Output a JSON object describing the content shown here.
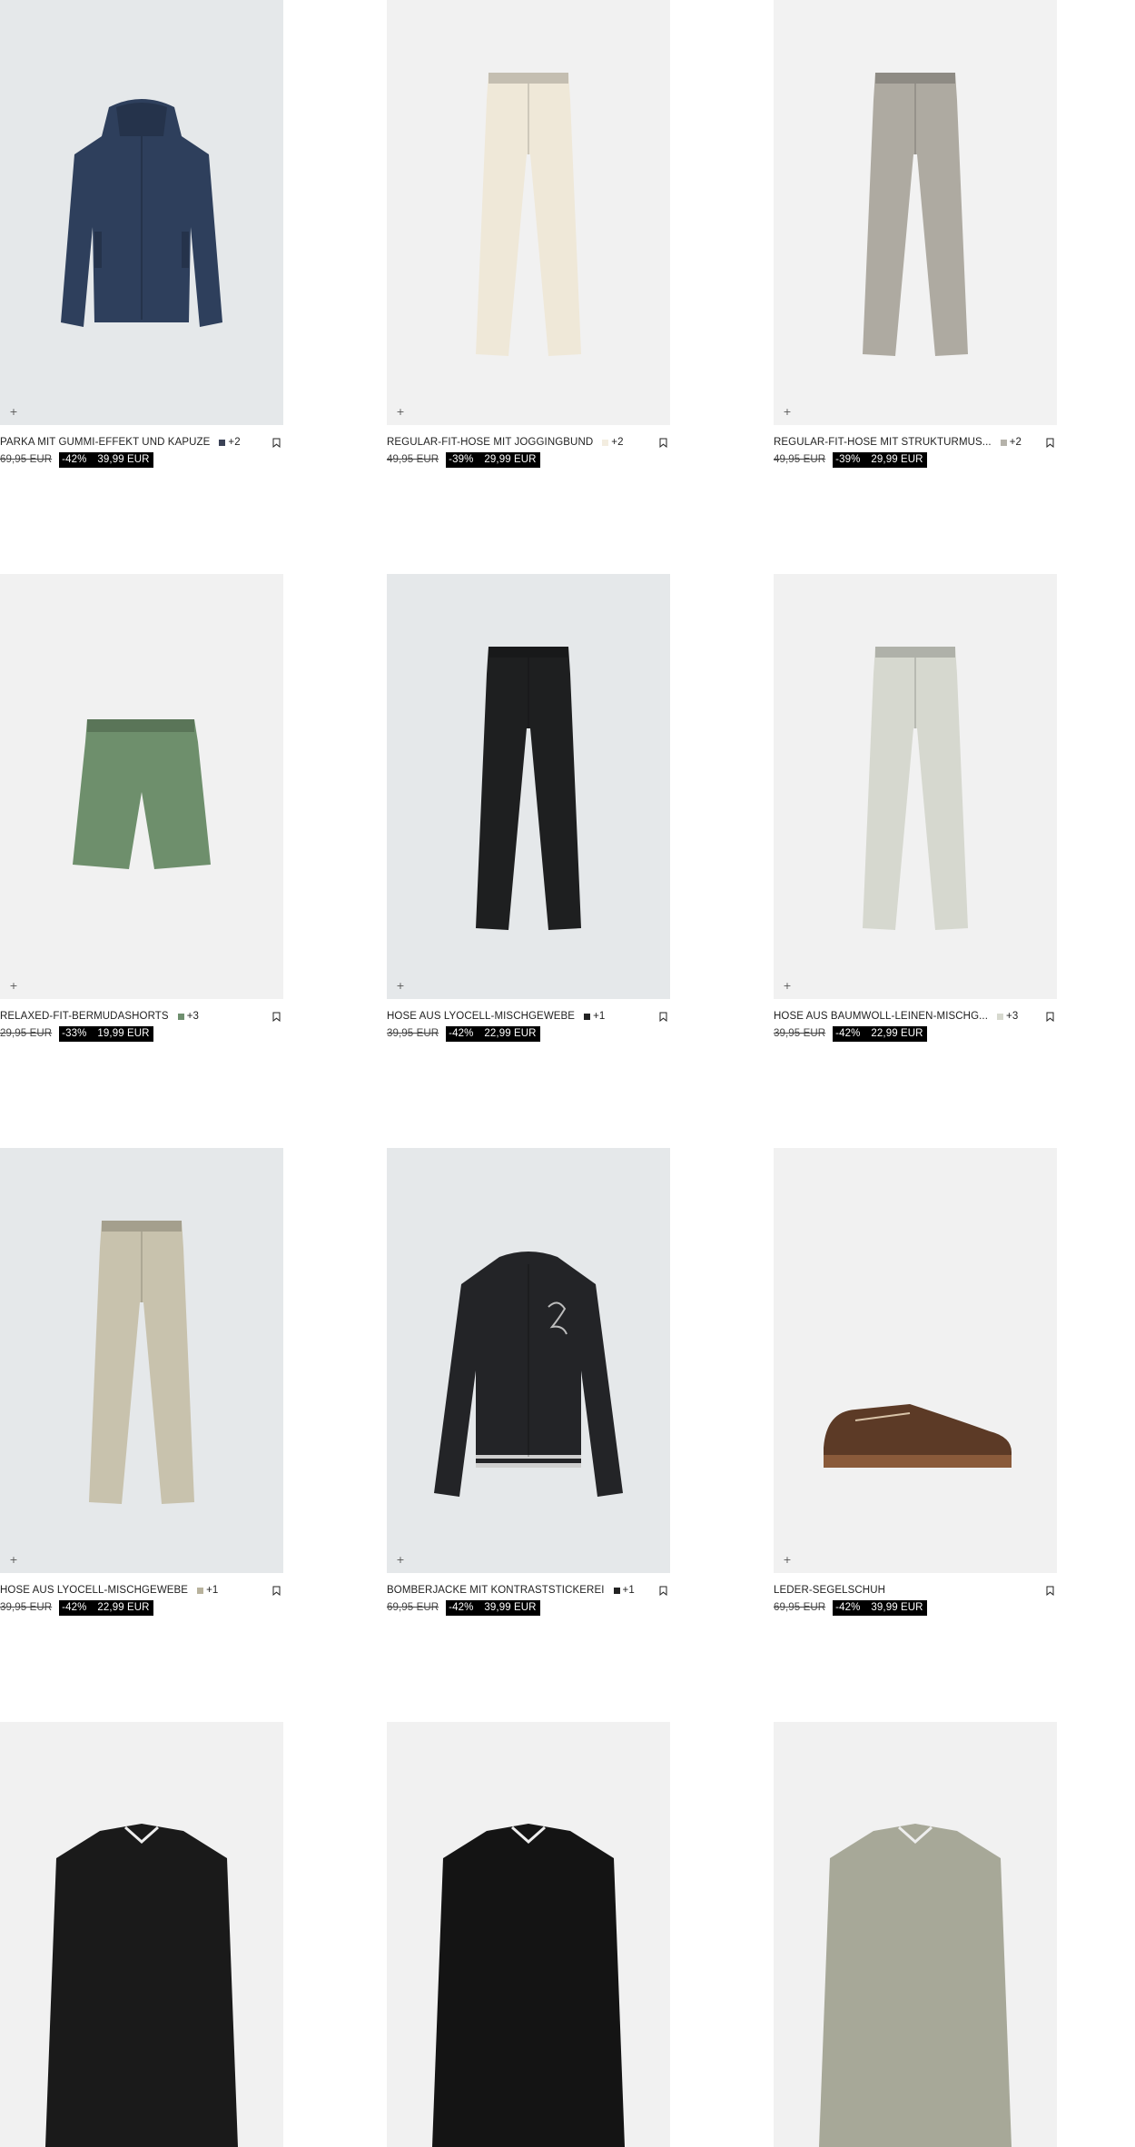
{
  "products": [
    {
      "name": "PARKA MIT GUMMI-EFFEKT UND KAPUZE",
      "swatch": "#3b4256",
      "more": "+2",
      "old_price": "69,95 EUR",
      "discount": "-42%",
      "price": "39,99 EUR",
      "bg": "#e5e8ea",
      "icon": "parka-image",
      "garment": "#2e3f5c"
    },
    {
      "name": "REGULAR-FIT-HOSE MIT JOGGINGBUND",
      "swatch": "#f3ede0",
      "more": "+2",
      "old_price": "49,95 EUR",
      "discount": "-39%",
      "price": "29,99 EUR",
      "bg": "#f1f1f1",
      "icon": "trousers-image",
      "garment": "#efe8d8"
    },
    {
      "name": "REGULAR-FIT-HOSE MIT STRUKTURMUS...",
      "swatch": "#b5b2aa",
      "more": "+2",
      "old_price": "49,95 EUR",
      "discount": "-39%",
      "price": "29,99 EUR",
      "bg": "#f2f2f2",
      "icon": "trousers-image",
      "garment": "#aeaaa1"
    },
    {
      "name": "RELAXED-FIT-BERMUDASHORTS",
      "swatch": "#6f8f6f",
      "more": "+3",
      "old_price": "29,95 EUR",
      "discount": "-33%",
      "price": "19,99 EUR",
      "bg": "#f1f1f1",
      "icon": "shorts-image",
      "garment": "#6e8f6c"
    },
    {
      "name": "HOSE AUS LYOCELL-MISCHGEWEBE",
      "swatch": "#222222",
      "more": "+1",
      "old_price": "39,95 EUR",
      "discount": "-42%",
      "price": "22,99 EUR",
      "bg": "#e5e8ea",
      "icon": "trousers-image",
      "garment": "#1e1f20"
    },
    {
      "name": "HOSE AUS BAUMWOLL-LEINEN-MISCHG...",
      "swatch": "#d7d9cf",
      "more": "+3",
      "old_price": "39,95 EUR",
      "discount": "-42%",
      "price": "22,99 EUR",
      "bg": "#f1f1f1",
      "icon": "trousers-image",
      "garment": "#d6d8cf"
    },
    {
      "name": "HOSE AUS LYOCELL-MISCHGEWEBE",
      "swatch": "#b8b29c",
      "more": "+1",
      "old_price": "39,95 EUR",
      "discount": "-42%",
      "price": "22,99 EUR",
      "bg": "#e5e8ea",
      "icon": "trousers-image",
      "garment": "#c8c2ad"
    },
    {
      "name": "BOMBERJACKE MIT KONTRASTSTICKEREI",
      "swatch": "#222222",
      "more": "+1",
      "old_price": "69,95 EUR",
      "discount": "-42%",
      "price": "39,99 EUR",
      "bg": "#e5e8ea",
      "icon": "bomber-jacket-image",
      "garment": "#232427"
    },
    {
      "name": "LEDER-SEGELSCHUH",
      "swatch": "",
      "more": "",
      "old_price": "69,95 EUR",
      "discount": "-42%",
      "price": "39,99 EUR",
      "bg": "#f1f1f1",
      "icon": "boat-shoe-image",
      "garment": "#5c3a26"
    },
    {
      "name": "",
      "swatch": "",
      "more": "",
      "old_price": "",
      "discount": "",
      "price": "",
      "bg": "#f1f1f1",
      "icon": "overshirt-image",
      "garment": "#1a1a1a"
    },
    {
      "name": "",
      "swatch": "",
      "more": "",
      "old_price": "",
      "discount": "",
      "price": "",
      "bg": "#f1f1f1",
      "icon": "overshirt-image",
      "garment": "#141414"
    },
    {
      "name": "",
      "swatch": "",
      "more": "",
      "old_price": "",
      "discount": "",
      "price": "",
      "bg": "#f1f1f1",
      "icon": "overshirt-image",
      "garment": "#a7a898"
    }
  ],
  "ui": {
    "add_icon": "plus-icon",
    "save_icon": "bookmark-icon",
    "add_glyph": "+"
  }
}
